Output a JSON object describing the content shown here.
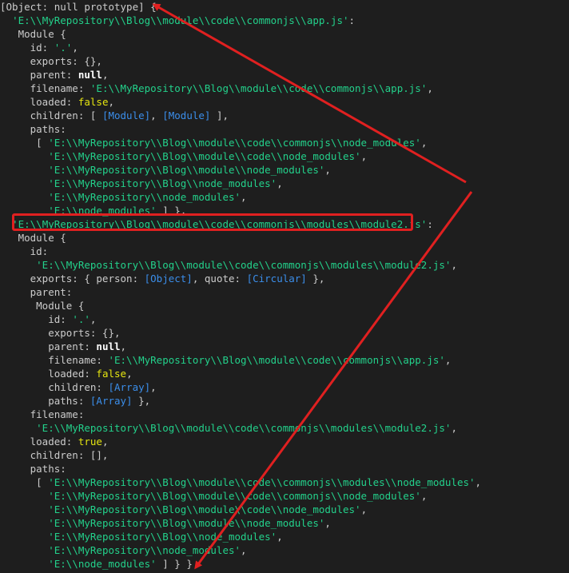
{
  "console": {
    "lines": [
      {
        "segments": [
          {
            "t": "[Object: null prototype] {",
            "c": "p"
          }
        ]
      },
      {
        "segments": [
          {
            "t": "  ",
            "c": "p"
          },
          {
            "t": "'E:\\\\MyRepository\\\\Blog\\\\module\\\\code\\\\commonjs\\\\app.js'",
            "c": "s"
          },
          {
            "t": ":",
            "c": "p"
          }
        ]
      },
      {
        "segments": [
          {
            "t": "   Module {",
            "c": "p"
          }
        ]
      },
      {
        "segments": [
          {
            "t": "     id: ",
            "c": "p"
          },
          {
            "t": "'.'",
            "c": "s"
          },
          {
            "t": ",",
            "c": "p"
          }
        ]
      },
      {
        "segments": [
          {
            "t": "     exports: {},",
            "c": "p"
          }
        ]
      },
      {
        "segments": [
          {
            "t": "     parent: ",
            "c": "p"
          },
          {
            "t": "null",
            "c": "kw"
          },
          {
            "t": ",",
            "c": "p"
          }
        ]
      },
      {
        "segments": [
          {
            "t": "     filename: ",
            "c": "p"
          },
          {
            "t": "'E:\\\\MyRepository\\\\Blog\\\\module\\\\code\\\\commonjs\\\\app.js'",
            "c": "s"
          },
          {
            "t": ",",
            "c": "p"
          }
        ]
      },
      {
        "segments": [
          {
            "t": "     loaded: ",
            "c": "p"
          },
          {
            "t": "false",
            "c": "b"
          },
          {
            "t": ",",
            "c": "p"
          }
        ]
      },
      {
        "segments": [
          {
            "t": "     children: [ ",
            "c": "p"
          },
          {
            "t": "[Module]",
            "c": "r"
          },
          {
            "t": ", ",
            "c": "p"
          },
          {
            "t": "[Module]",
            "c": "r"
          },
          {
            "t": " ],",
            "c": "p"
          }
        ]
      },
      {
        "segments": [
          {
            "t": "     paths:",
            "c": "p"
          }
        ]
      },
      {
        "segments": [
          {
            "t": "      [ ",
            "c": "p"
          },
          {
            "t": "'E:\\\\MyRepository\\\\Blog\\\\module\\\\code\\\\commonjs\\\\node_modules'",
            "c": "s"
          },
          {
            "t": ",",
            "c": "p"
          }
        ]
      },
      {
        "segments": [
          {
            "t": "        ",
            "c": "p"
          },
          {
            "t": "'E:\\\\MyRepository\\\\Blog\\\\module\\\\code\\\\node_modules'",
            "c": "s"
          },
          {
            "t": ",",
            "c": "p"
          }
        ]
      },
      {
        "segments": [
          {
            "t": "        ",
            "c": "p"
          },
          {
            "t": "'E:\\\\MyRepository\\\\Blog\\\\module\\\\node_modules'",
            "c": "s"
          },
          {
            "t": ",",
            "c": "p"
          }
        ]
      },
      {
        "segments": [
          {
            "t": "        ",
            "c": "p"
          },
          {
            "t": "'E:\\\\MyRepository\\\\Blog\\\\node_modules'",
            "c": "s"
          },
          {
            "t": ",",
            "c": "p"
          }
        ]
      },
      {
        "segments": [
          {
            "t": "        ",
            "c": "p"
          },
          {
            "t": "'E:\\\\MyRepository\\\\node_modules'",
            "c": "s"
          },
          {
            "t": ",",
            "c": "p"
          }
        ]
      },
      {
        "segments": [
          {
            "t": "        ",
            "c": "p"
          },
          {
            "t": "'E:\\\\node_modules'",
            "c": "s"
          },
          {
            "t": " ] },",
            "c": "p"
          }
        ]
      },
      {
        "segments": [
          {
            "t": "  ",
            "c": "p"
          },
          {
            "t": "'E:\\\\MyRepository\\\\Blog\\\\module\\\\code\\\\commonjs\\\\modules\\\\module2.js'",
            "c": "s"
          },
          {
            "t": ":",
            "c": "p"
          }
        ]
      },
      {
        "segments": [
          {
            "t": "   Module {",
            "c": "p"
          }
        ]
      },
      {
        "segments": [
          {
            "t": "     id:",
            "c": "p"
          }
        ]
      },
      {
        "segments": [
          {
            "t": "      ",
            "c": "p"
          },
          {
            "t": "'E:\\\\MyRepository\\\\Blog\\\\module\\\\code\\\\commonjs\\\\modules\\\\module2.js'",
            "c": "s"
          },
          {
            "t": ",",
            "c": "p"
          }
        ]
      },
      {
        "segments": [
          {
            "t": "     exports: { person: ",
            "c": "p"
          },
          {
            "t": "[Object]",
            "c": "r"
          },
          {
            "t": ", quote: ",
            "c": "p"
          },
          {
            "t": "[Circular]",
            "c": "r"
          },
          {
            "t": " },",
            "c": "p"
          }
        ]
      },
      {
        "segments": [
          {
            "t": "     parent:",
            "c": "p"
          }
        ]
      },
      {
        "segments": [
          {
            "t": "      Module {",
            "c": "p"
          }
        ]
      },
      {
        "segments": [
          {
            "t": "        id: ",
            "c": "p"
          },
          {
            "t": "'.'",
            "c": "s"
          },
          {
            "t": ",",
            "c": "p"
          }
        ]
      },
      {
        "segments": [
          {
            "t": "        exports: {},",
            "c": "p"
          }
        ]
      },
      {
        "segments": [
          {
            "t": "        parent: ",
            "c": "p"
          },
          {
            "t": "null",
            "c": "kw"
          },
          {
            "t": ",",
            "c": "p"
          }
        ]
      },
      {
        "segments": [
          {
            "t": "        filename: ",
            "c": "p"
          },
          {
            "t": "'E:\\\\MyRepository\\\\Blog\\\\module\\\\code\\\\commonjs\\\\app.js'",
            "c": "s"
          },
          {
            "t": ",",
            "c": "p"
          }
        ]
      },
      {
        "segments": [
          {
            "t": "        loaded: ",
            "c": "p"
          },
          {
            "t": "false",
            "c": "b"
          },
          {
            "t": ",",
            "c": "p"
          }
        ]
      },
      {
        "segments": [
          {
            "t": "        children: ",
            "c": "p"
          },
          {
            "t": "[Array]",
            "c": "r"
          },
          {
            "t": ",",
            "c": "p"
          }
        ]
      },
      {
        "segments": [
          {
            "t": "        paths: ",
            "c": "p"
          },
          {
            "t": "[Array]",
            "c": "r"
          },
          {
            "t": " },",
            "c": "p"
          }
        ]
      },
      {
        "segments": [
          {
            "t": "     filename:",
            "c": "p"
          }
        ]
      },
      {
        "segments": [
          {
            "t": "      ",
            "c": "p"
          },
          {
            "t": "'E:\\\\MyRepository\\\\Blog\\\\module\\\\code\\\\commonjs\\\\modules\\\\module2.js'",
            "c": "s"
          },
          {
            "t": ",",
            "c": "p"
          }
        ]
      },
      {
        "segments": [
          {
            "t": "     loaded: ",
            "c": "p"
          },
          {
            "t": "true",
            "c": "b"
          },
          {
            "t": ",",
            "c": "p"
          }
        ]
      },
      {
        "segments": [
          {
            "t": "     children: [],",
            "c": "p"
          }
        ]
      },
      {
        "segments": [
          {
            "t": "     paths:",
            "c": "p"
          }
        ]
      },
      {
        "segments": [
          {
            "t": "      [ ",
            "c": "p"
          },
          {
            "t": "'E:\\\\MyRepository\\\\Blog\\\\module\\\\code\\\\commonjs\\\\modules\\\\node_modules'",
            "c": "s"
          },
          {
            "t": ",",
            "c": "p"
          }
        ]
      },
      {
        "segments": [
          {
            "t": "        ",
            "c": "p"
          },
          {
            "t": "'E:\\\\MyRepository\\\\Blog\\\\module\\\\code\\\\commonjs\\\\node_modules'",
            "c": "s"
          },
          {
            "t": ",",
            "c": "p"
          }
        ]
      },
      {
        "segments": [
          {
            "t": "        ",
            "c": "p"
          },
          {
            "t": "'E:\\\\MyRepository\\\\Blog\\\\module\\\\code\\\\node_modules'",
            "c": "s"
          },
          {
            "t": ",",
            "c": "p"
          }
        ]
      },
      {
        "segments": [
          {
            "t": "        ",
            "c": "p"
          },
          {
            "t": "'E:\\\\MyRepository\\\\Blog\\\\module\\\\node_modules'",
            "c": "s"
          },
          {
            "t": ",",
            "c": "p"
          }
        ]
      },
      {
        "segments": [
          {
            "t": "        ",
            "c": "p"
          },
          {
            "t": "'E:\\\\MyRepository\\\\Blog\\\\node_modules'",
            "c": "s"
          },
          {
            "t": ",",
            "c": "p"
          }
        ]
      },
      {
        "segments": [
          {
            "t": "        ",
            "c": "p"
          },
          {
            "t": "'E:\\\\MyRepository\\\\node_modules'",
            "c": "s"
          },
          {
            "t": ",",
            "c": "p"
          }
        ]
      },
      {
        "segments": [
          {
            "t": "        ",
            "c": "p"
          },
          {
            "t": "'E:\\\\node_modules'",
            "c": "s"
          },
          {
            "t": " ] } }",
            "c": "p"
          }
        ]
      }
    ]
  },
  "colors": {
    "background": "#1e1e1e",
    "text": "#cccccc",
    "string": "#23d18b",
    "boolean": "#e5e510",
    "reference": "#3b8eea",
    "annotation": "#e02020"
  },
  "annotations": {
    "highlighted_line_index": 16,
    "arrow_icon": "red-arrow"
  }
}
